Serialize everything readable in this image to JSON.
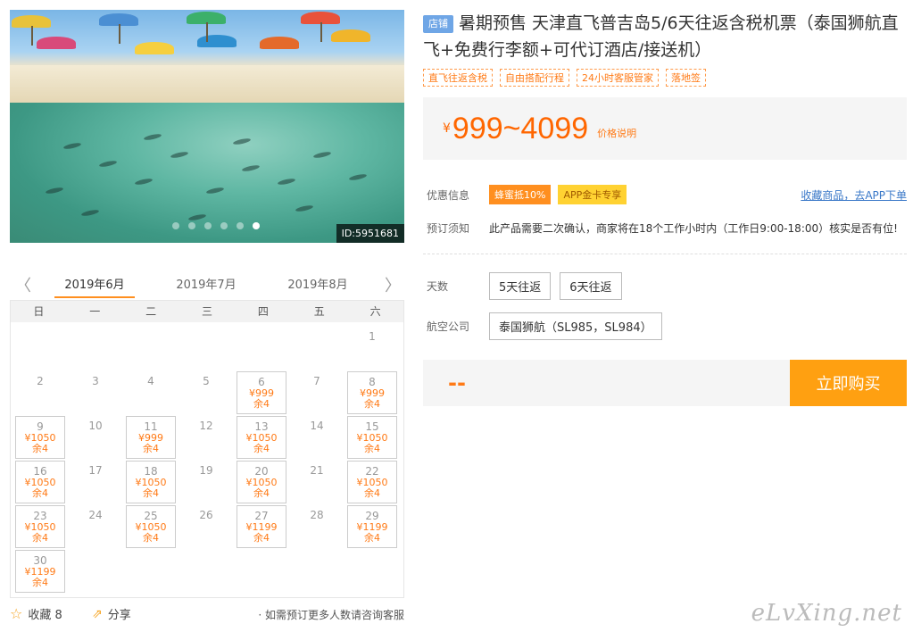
{
  "hero": {
    "id_label": "ID:5951681",
    "slide_count": 6,
    "active_slide": 6
  },
  "calendar": {
    "prev_arrow": "〈",
    "next_arrow": "〉",
    "months": [
      "2019年6月",
      "2019年7月",
      "2019年8月"
    ],
    "active_month": 0,
    "weekdays": [
      "日",
      "一",
      "二",
      "三",
      "四",
      "五",
      "六"
    ],
    "leading_blanks": 6,
    "days": [
      {
        "d": "1"
      },
      {
        "d": "2"
      },
      {
        "d": "3"
      },
      {
        "d": "4"
      },
      {
        "d": "5"
      },
      {
        "d": "6",
        "price": "¥999",
        "left": "余4"
      },
      {
        "d": "7"
      },
      {
        "d": "8",
        "price": "¥999",
        "left": "余4"
      },
      {
        "d": "9",
        "price": "¥1050",
        "left": "余4"
      },
      {
        "d": "10"
      },
      {
        "d": "11",
        "price": "¥999",
        "left": "余4"
      },
      {
        "d": "12"
      },
      {
        "d": "13",
        "price": "¥1050",
        "left": "余4"
      },
      {
        "d": "14"
      },
      {
        "d": "15",
        "price": "¥1050",
        "left": "余4"
      },
      {
        "d": "16",
        "price": "¥1050",
        "left": "余4"
      },
      {
        "d": "17"
      },
      {
        "d": "18",
        "price": "¥1050",
        "left": "余4"
      },
      {
        "d": "19"
      },
      {
        "d": "20",
        "price": "¥1050",
        "left": "余4"
      },
      {
        "d": "21"
      },
      {
        "d": "22",
        "price": "¥1050",
        "left": "余4"
      },
      {
        "d": "23",
        "price": "¥1050",
        "left": "余4"
      },
      {
        "d": "24"
      },
      {
        "d": "25",
        "price": "¥1050",
        "left": "余4"
      },
      {
        "d": "26"
      },
      {
        "d": "27",
        "price": "¥1199",
        "left": "余4"
      },
      {
        "d": "28"
      },
      {
        "d": "29",
        "price": "¥1199",
        "left": "余4"
      },
      {
        "d": "30",
        "price": "¥1199",
        "left": "余4"
      }
    ]
  },
  "footer": {
    "favorite_label": "收藏 8",
    "share_label": "分享",
    "note": "· 如需预订更多人数请咨询客服"
  },
  "product": {
    "shop_tag": "店铺",
    "title": "暑期预售 天津直飞普吉岛5/6天往返含税机票（泰国狮航直飞+免费行李额+可代订酒店/接送机）",
    "tags": [
      "直飞往返含税",
      "自由搭配行程",
      "24小时客服管家",
      "落地签"
    ],
    "price_symbol": "¥",
    "price": "999~4099",
    "price_note": "价格说明",
    "promo_label": "优惠信息",
    "promo_badge1": "蜂蜜抵10%",
    "promo_badge2": "APP金卡专享",
    "promo_link": "收藏商品，去APP下单",
    "notice_label": "预订须知",
    "notice_text": "此产品需要二次确认，商家将在18个工作小时内（工作日9:00-18:00）核实是否有位!",
    "days_label": "天数",
    "days_options": [
      "5天往返",
      "6天往返"
    ],
    "airline_label": "航空公司",
    "airline_option": "泰国狮航（SL985，SL984）",
    "total_placeholder": "--",
    "buy_label": "立即购买"
  },
  "watermark": "eLvXing.net",
  "colors": {
    "accent": "#ff7a16",
    "buy_button": "#ffa011",
    "shop_tag": "#6fa6e6",
    "link": "#3a78c8"
  }
}
